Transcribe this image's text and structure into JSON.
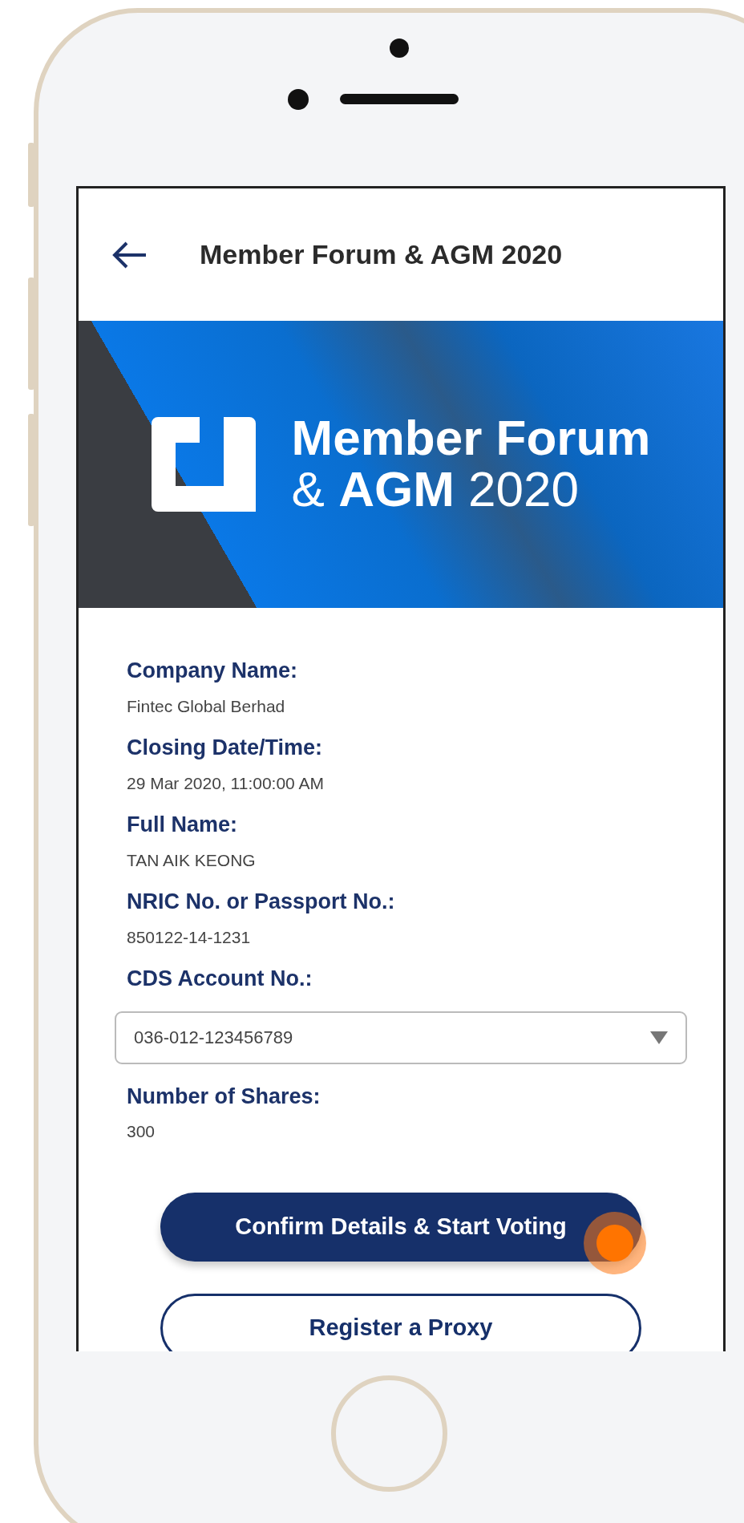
{
  "header": {
    "title": "Member Forum & AGM 2020"
  },
  "banner": {
    "line1": "Member Forum",
    "line2": "& **AGM** 2020"
  },
  "fields": [
    {
      "kind": "text",
      "label": "Company Name:",
      "value": "Fintec Global Berhad"
    },
    {
      "kind": "text",
      "label": "Closing Date/Time:",
      "value": "29 Mar 2020, 11:00:00 AM"
    },
    {
      "kind": "text",
      "label": "Full Name:",
      "value": "TAN AIK KEONG"
    },
    {
      "kind": "text",
      "label": "NRIC No. or Passport No.:",
      "value": "850122-14-1231"
    },
    {
      "kind": "select",
      "label": "CDS Account No.:",
      "value": "036-012-123456789"
    },
    {
      "kind": "text",
      "label": "Number of Shares:",
      "value": "300"
    }
  ],
  "buttons": [
    {
      "kind": "primary",
      "label": "Confirm Details & Start Voting"
    },
    {
      "kind": "outline",
      "label": "Register a Proxy"
    }
  ]
}
